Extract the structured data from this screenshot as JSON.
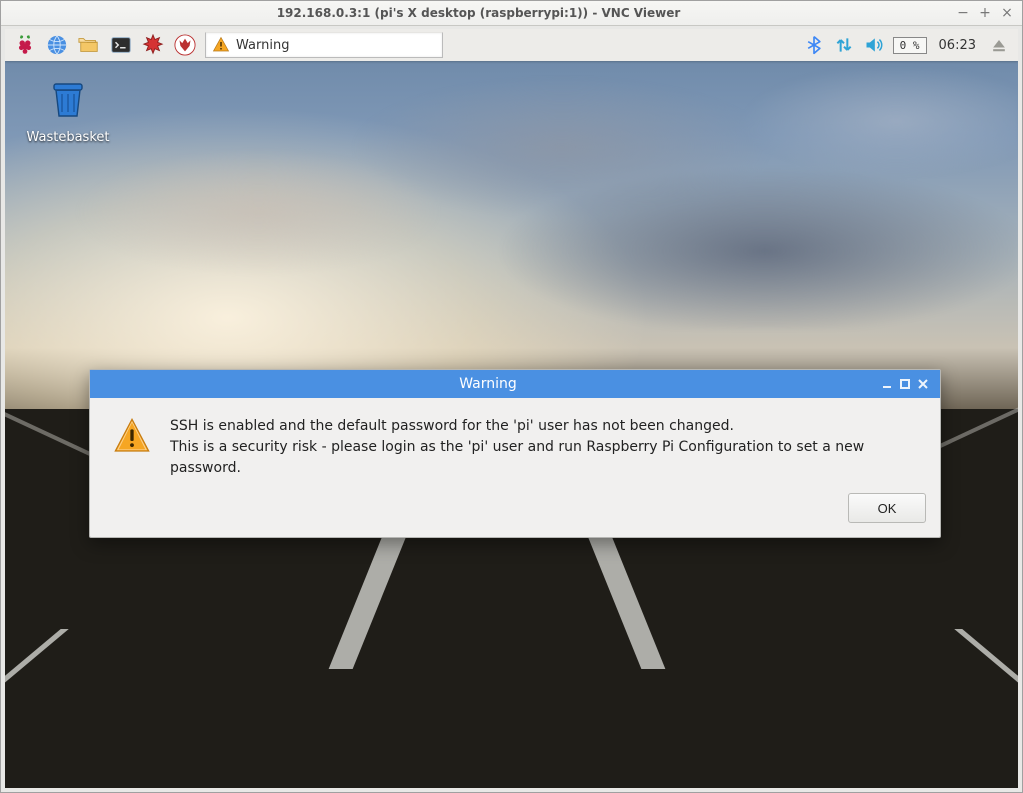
{
  "vnc": {
    "title": "192.168.0.3:1 (pi's X desktop (raspberrypi:1)) - VNC Viewer",
    "min": "−",
    "max": "+",
    "close": "×"
  },
  "panel": {
    "task": {
      "label": "Warning"
    },
    "cpu": "0 %",
    "clock": "06:23"
  },
  "desktop": {
    "wastebasket": "Wastebasket"
  },
  "dialog": {
    "title": "Warning",
    "line1": "SSH is enabled and the default password for the 'pi' user has not been changed.",
    "line2": "This is a security risk - please login as the 'pi' user and run Raspberry Pi Configuration to set a new password.",
    "ok": "OK"
  }
}
